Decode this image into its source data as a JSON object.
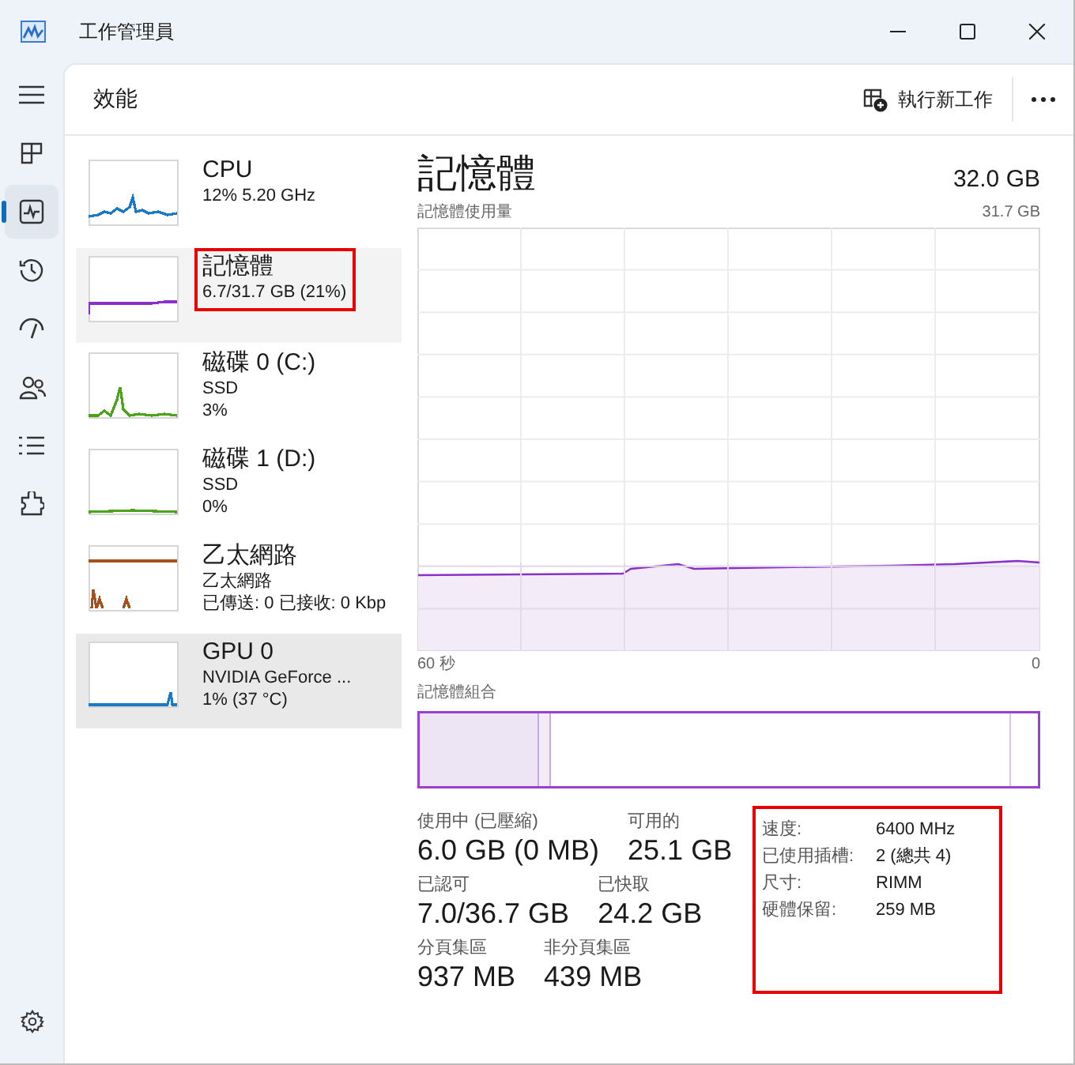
{
  "window": {
    "title": "工作管理員"
  },
  "nav": [
    {
      "kind": "menu",
      "selected": false
    },
    {
      "kind": "processes",
      "selected": false
    },
    {
      "kind": "performance",
      "selected": true
    },
    {
      "kind": "history",
      "selected": false
    },
    {
      "kind": "startup",
      "selected": false
    },
    {
      "kind": "users",
      "selected": false
    },
    {
      "kind": "details",
      "selected": false
    },
    {
      "kind": "services",
      "selected": false
    },
    {
      "kind": "settings",
      "selected": false
    }
  ],
  "header": {
    "title": "效能",
    "run_task_button": "執行新工作"
  },
  "devices": [
    {
      "name": "CPU",
      "lines": [
        "12%  5.20 GHz"
      ],
      "color": "#1a7ac4",
      "selected": false,
      "hovered": false,
      "highlighted": false
    },
    {
      "name": "記憶體",
      "lines": [
        "6.7/31.7 GB (21%)"
      ],
      "color": "#8b2fc9",
      "selected": true,
      "hovered": false,
      "highlighted": true
    },
    {
      "name": "磁碟 0 (C:)",
      "lines": [
        "SSD",
        "3%"
      ],
      "color": "#4ca21b",
      "selected": false,
      "hovered": false,
      "highlighted": false
    },
    {
      "name": "磁碟 1 (D:)",
      "lines": [
        "SSD",
        "0%"
      ],
      "color": "#4ca21b",
      "selected": false,
      "hovered": false,
      "highlighted": false
    },
    {
      "name": "乙太網路",
      "lines": [
        "乙太網路",
        "已傳送: 0 已接收: 0 Kbp"
      ],
      "color": "#a7501c",
      "selected": false,
      "hovered": false,
      "highlighted": false
    },
    {
      "name": "GPU 0",
      "lines": [
        "NVIDIA GeForce ...",
        "1%  (37 °C)"
      ],
      "color": "#1a7ac4",
      "selected": false,
      "hovered": true,
      "highlighted": false
    }
  ],
  "detail": {
    "title": "記憶體",
    "total": "32.0 GB",
    "usage_label": "記憶體使用量",
    "usage_max": "31.7 GB",
    "x_start": "60 秒",
    "x_end": "0",
    "composition_label": "記憶體組合",
    "stats": [
      [
        {
          "label": "使用中 (已壓縮)",
          "value": "6.0 GB (0 MB)"
        },
        {
          "label": "可用的",
          "value": "25.1 GB"
        }
      ],
      [
        {
          "label": "已認可",
          "value": "7.0/36.7 GB"
        },
        {
          "label": "已快取",
          "value": "24.2 GB"
        }
      ],
      [
        {
          "label": "分頁集區",
          "value": "937 MB"
        },
        {
          "label": "非分頁集區",
          "value": "439 MB"
        }
      ]
    ],
    "specs_highlighted": true,
    "specs": [
      {
        "label": "速度:",
        "value": "6400 MHz"
      },
      {
        "label": "已使用插槽:",
        "value": "2 (總共 4)"
      },
      {
        "label": "尺寸:",
        "value": "RIMM"
      },
      {
        "label": "硬體保留:",
        "value": "259 MB"
      }
    ]
  }
}
